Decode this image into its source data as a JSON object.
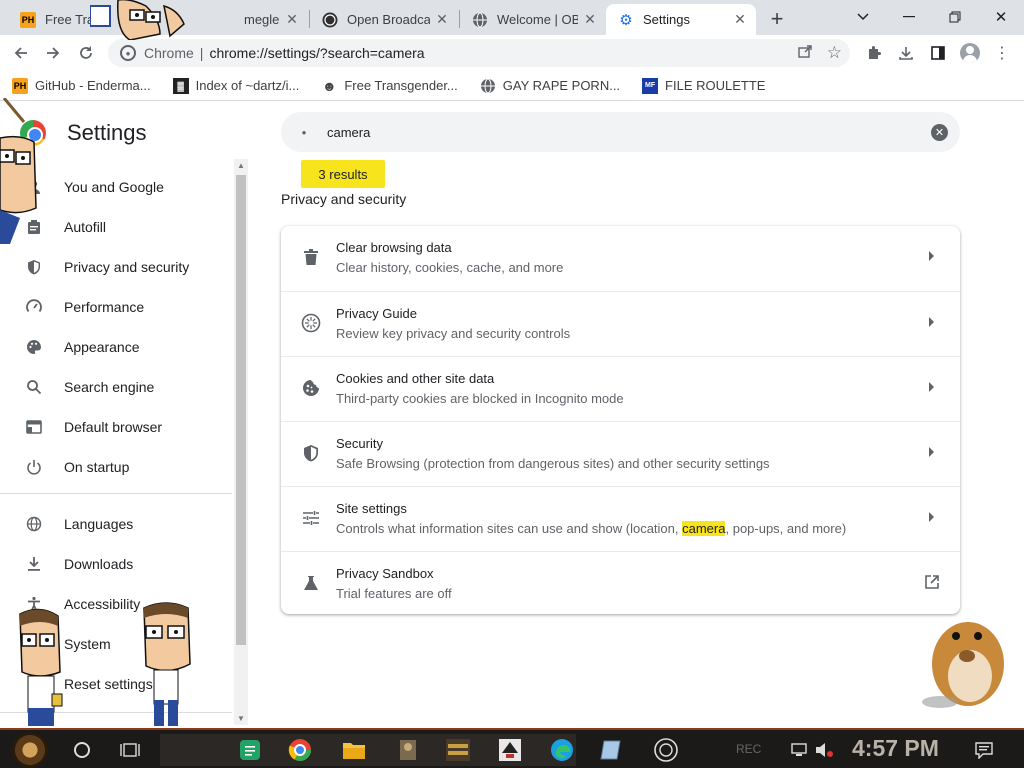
{
  "tabs": [
    {
      "title": "Free Tra",
      "favicon": "ph-icon"
    },
    {
      "title": "megle: Talk t",
      "favicon": "omegle-icon"
    },
    {
      "title": "Open Broadcas",
      "favicon": "obs-icon"
    },
    {
      "title": "Welcome | OB",
      "favicon": "globe-icon"
    },
    {
      "title": "Settings",
      "favicon": "gear-icon",
      "active": true
    }
  ],
  "toolbar": {
    "omnibox_prefix": "Chrome",
    "url": "chrome://settings/?search=camera"
  },
  "bookmarks": [
    {
      "label": "GitHub - Enderma...",
      "icon": "PH"
    },
    {
      "label": "Index of ~dartz/i...",
      "icon": "▓"
    },
    {
      "label": "Free Transgender...",
      "icon": "☻"
    },
    {
      "label": "GAY RAPE PORN...",
      "icon": ""
    },
    {
      "label": "FILE ROULETTE",
      "icon": "MF"
    }
  ],
  "settings": {
    "title": "Settings",
    "search_value": "camera",
    "results_count": "3 results",
    "section_title": "Privacy and security"
  },
  "sidebar": {
    "items": [
      {
        "label": "You and Google",
        "icon": "person-icon"
      },
      {
        "label": "Autofill",
        "icon": "clipboard-icon"
      },
      {
        "label": "Privacy and security",
        "icon": "shield-icon"
      },
      {
        "label": "Performance",
        "icon": "speedometer-icon"
      },
      {
        "label": "Appearance",
        "icon": "palette-icon"
      },
      {
        "label": "Search engine",
        "icon": "search-icon"
      },
      {
        "label": "Default browser",
        "icon": "browser-icon"
      },
      {
        "label": "On startup",
        "icon": "power-icon"
      },
      {
        "label": "Languages",
        "icon": "globe-icon"
      },
      {
        "label": "Downloads",
        "icon": "download-icon"
      },
      {
        "label": "Accessibility",
        "icon": "accessibility-icon"
      },
      {
        "label": "System",
        "icon": "wrench-icon"
      },
      {
        "label": "Reset settings",
        "icon": "reset-icon"
      }
    ]
  },
  "rows": [
    {
      "title": "Clear browsing data",
      "subtitle": "Clear history, cookies, cache, and more",
      "icon": "trash-icon"
    },
    {
      "title": "Privacy Guide",
      "subtitle": "Review key privacy and security controls",
      "icon": "compass-icon"
    },
    {
      "title": "Cookies and other site data",
      "subtitle": "Third-party cookies are blocked in Incognito mode",
      "icon": "cookie-icon"
    },
    {
      "title": "Security",
      "subtitle": "Safe Browsing (protection from dangerous sites) and other security settings",
      "icon": "shield-icon"
    },
    {
      "title": "Site settings",
      "subtitle_before": "Controls what information sites can use and show (location, ",
      "subtitle_highlight": "camera",
      "subtitle_after": ", pop-ups, and more)",
      "icon": "sliders-icon"
    },
    {
      "title": "Privacy Sandbox",
      "subtitle": "Trial features are off",
      "icon": "flask-icon"
    }
  ],
  "taskbar": {
    "clock": "4:57 PM",
    "tray_text": "REC"
  },
  "colors": {
    "highlight": "#f8e41c",
    "accent": "#1a73e8",
    "taskbar_bg": "#1c1a18"
  }
}
